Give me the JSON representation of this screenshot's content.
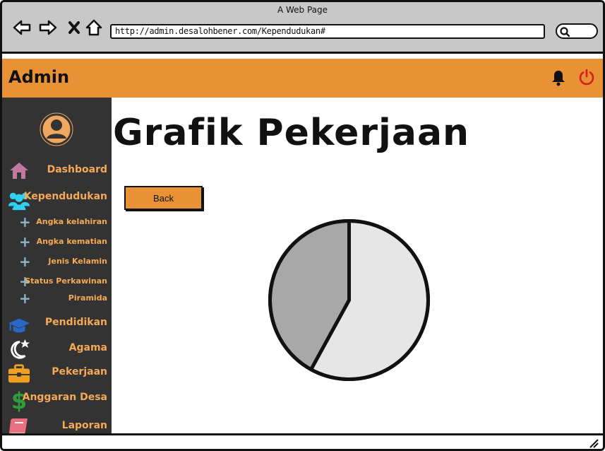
{
  "browser": {
    "window_title": "A Web Page",
    "url": "http://admin.desalohbener.com/Kependudukan#"
  },
  "header": {
    "title": "Admin",
    "accent_color": "#e89235"
  },
  "sidebar": {
    "items": [
      {
        "label": "Dashboard",
        "icon": "home-icon"
      },
      {
        "label": "Kependudukan",
        "icon": "users-icon"
      },
      {
        "label": "Pendidikan",
        "icon": "graduation-cap-icon"
      },
      {
        "label": "Agama",
        "icon": "moon-star-icon"
      },
      {
        "label": "Pekerjaan",
        "icon": "briefcase-icon"
      },
      {
        "label": "Anggaran Desa",
        "icon": "dollar-icon"
      },
      {
        "label": "Laporan",
        "icon": "book-icon"
      }
    ],
    "subitems": [
      {
        "label": "Angka kelahiran"
      },
      {
        "label": "Angka kematian"
      },
      {
        "label": "Jenis Kelamin"
      },
      {
        "label": "Status Perkawinan"
      },
      {
        "label": "Piramida"
      }
    ]
  },
  "main": {
    "title": "Grafik Pekerjaan",
    "back_label": "Back"
  },
  "chart_data": {
    "type": "pie",
    "title": "",
    "values": [
      58,
      42
    ],
    "colors": [
      "#e6e6e6",
      "#a8a8a8"
    ]
  }
}
